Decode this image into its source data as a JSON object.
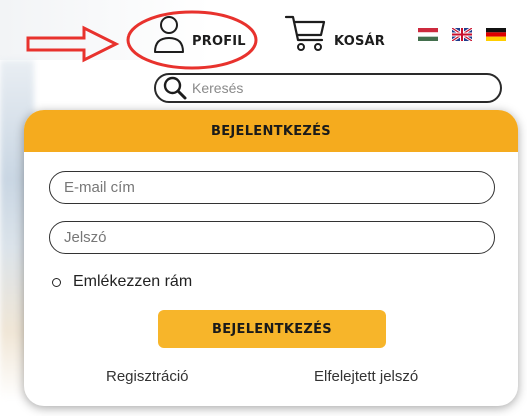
{
  "header": {
    "profile_label": "PROFIL",
    "cart_label": "KOSÁR",
    "languages": [
      "hu",
      "en",
      "de"
    ]
  },
  "search": {
    "placeholder": "Keresés"
  },
  "login": {
    "title": "BEJELENTKEZÉS",
    "email_placeholder": "E-mail cím",
    "password_placeholder": "Jelszó",
    "remember_label": "Emlékezzen rám",
    "submit_label": "BEJELENTKEZÉS",
    "register_link": "Regisztráció",
    "forgot_link": "Elfelejtett jelszó"
  },
  "colors": {
    "accent": "#f5ab1e",
    "button": "#f7b52a",
    "annotation": "#e8322d"
  },
  "icons": {
    "profile": "user-icon",
    "cart": "cart-icon",
    "search": "search-icon"
  }
}
